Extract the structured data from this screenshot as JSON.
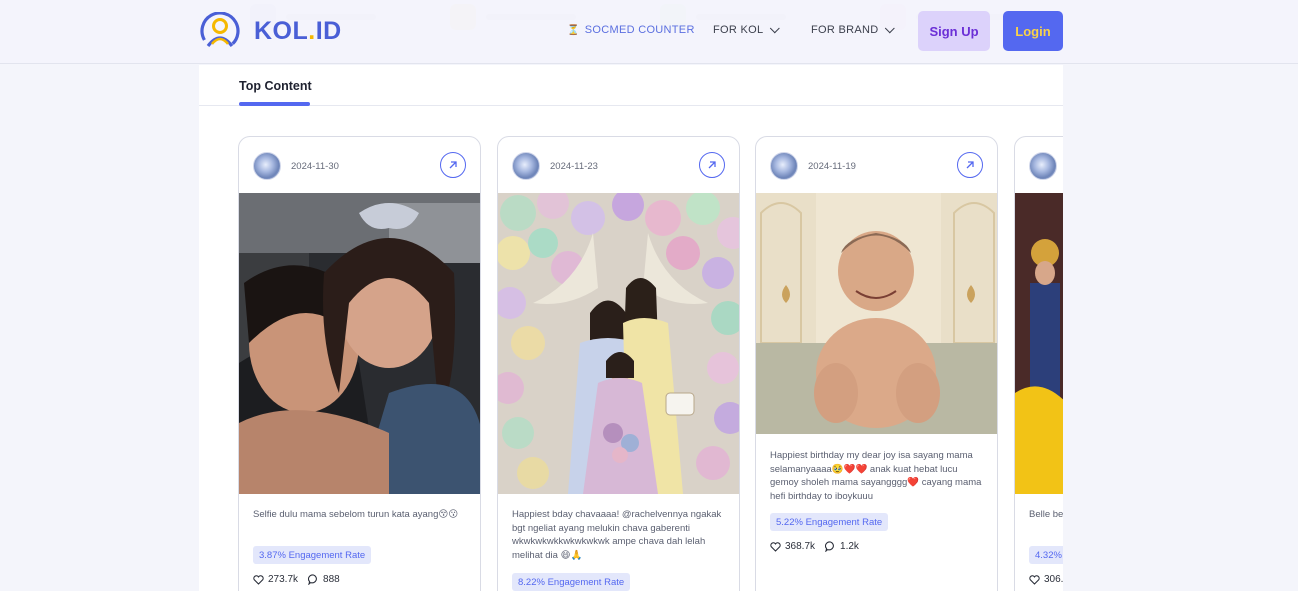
{
  "brand": {
    "name_prefix": "KOL",
    "name_dot": ".",
    "name_suffix": "ID"
  },
  "nav": {
    "socmed_counter": "SOCMED COUNTER",
    "for_kol": "FOR KOL",
    "for_brand": "FOR BRAND",
    "signup": "Sign Up",
    "login": "Login"
  },
  "colors": {
    "accent": "#5468f0",
    "signup_bg": "#dcd2fb",
    "signup_text": "#6b2fd6",
    "login_text": "#f8d24a",
    "badge_bg": "#e3e7fb"
  },
  "tabs": {
    "active": "Top Content"
  },
  "cards": [
    {
      "date": "2024-11-30",
      "caption": "Selfie dulu mama sebelom turun kata ayang😚😗",
      "engagement": "3.87% Engagement Rate",
      "likes": "273.7k",
      "comments": "888"
    },
    {
      "date": "2024-11-23",
      "caption": "Happiest bday chavaaaa! @rachelvennya ngakak bgt ngeliat ayang melukin chava gaberenti wkwkwkwkkwkwkwkwk ampe chava dah lelah melihat dia 😄🙏",
      "engagement": "8.22% Engagement Rate",
      "likes": "",
      "comments": ""
    },
    {
      "date": "2024-11-19",
      "caption": "Happiest birthday my dear joy isa sayang mama selamanyaaaa🥹❤️❤️ anak kuat hebat lucu gemoy sholeh mama sayangggg❤️ cayang mama hefi birthday to iboykuuu",
      "engagement": "5.22% Engagement Rate",
      "likes": "368.7k",
      "comments": "1.2k"
    },
    {
      "date": "",
      "caption": "Belle be",
      "engagement": "4.32%",
      "likes": "306.",
      "comments": ""
    }
  ],
  "icons": {
    "open": "arrow-up-right-icon",
    "like": "heart-icon",
    "comment": "comment-icon",
    "chevron": "chevron-down-icon",
    "counter": "hourglass-icon"
  }
}
